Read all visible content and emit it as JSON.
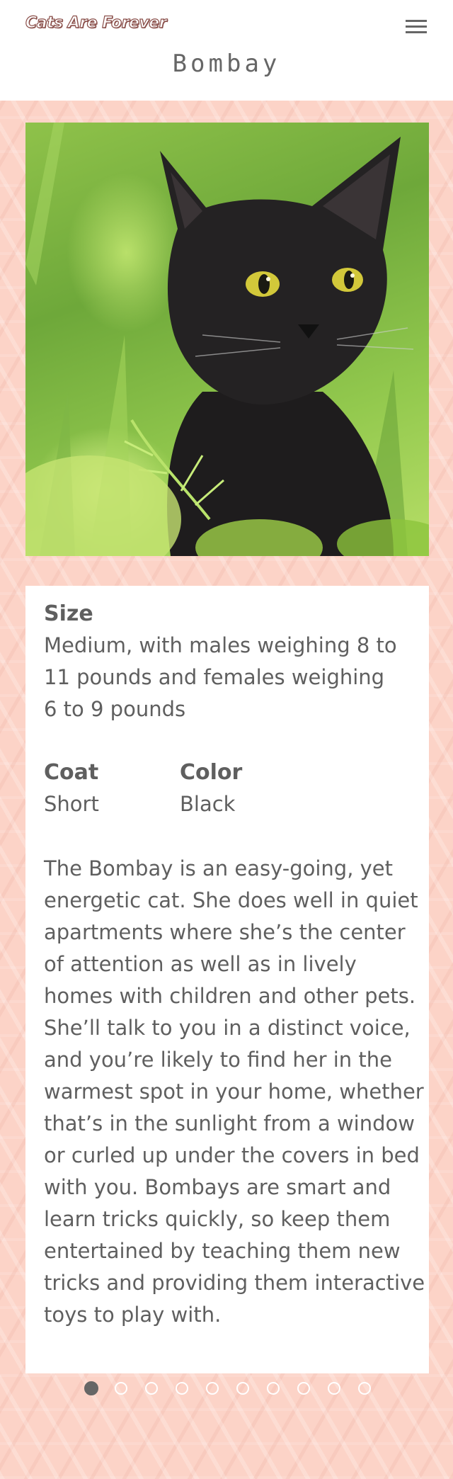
{
  "header": {
    "logo_text": "Cats Are Forever",
    "menu_icon": "hamburger-menu-icon"
  },
  "page": {
    "title": "Bombay"
  },
  "hero_image": {
    "alt": "Black cat with yellow eyes sitting in green grass"
  },
  "details": {
    "size_label": "Size",
    "size_value": "Medium, with males weighing 8 to 11 pounds and females weighing 6 to 9 pounds",
    "coat_label": "Coat",
    "coat_value": "Short",
    "color_label": "Color",
    "color_value": "Black",
    "description": "The Bombay is an easy-going, yet energetic cat. She does well in quiet apartments where she’s the center of attention as well as in lively homes with children and other pets. She’ll talk to you in a distinct voice, and you’re likely to find her in the warmest spot in your home, whether that’s in the sunlight from a window or curled up under the covers in bed with you. Bombays are smart and learn tricks quickly, so keep them entertained by teaching them new tricks and providing them interactive toys to play with."
  },
  "pager": {
    "total": 10,
    "active_index": 0
  },
  "colors": {
    "background_pattern": "#fcd3c7",
    "card": "#ffffff",
    "text": "#5f5f5f",
    "active_dot": "#666666"
  }
}
